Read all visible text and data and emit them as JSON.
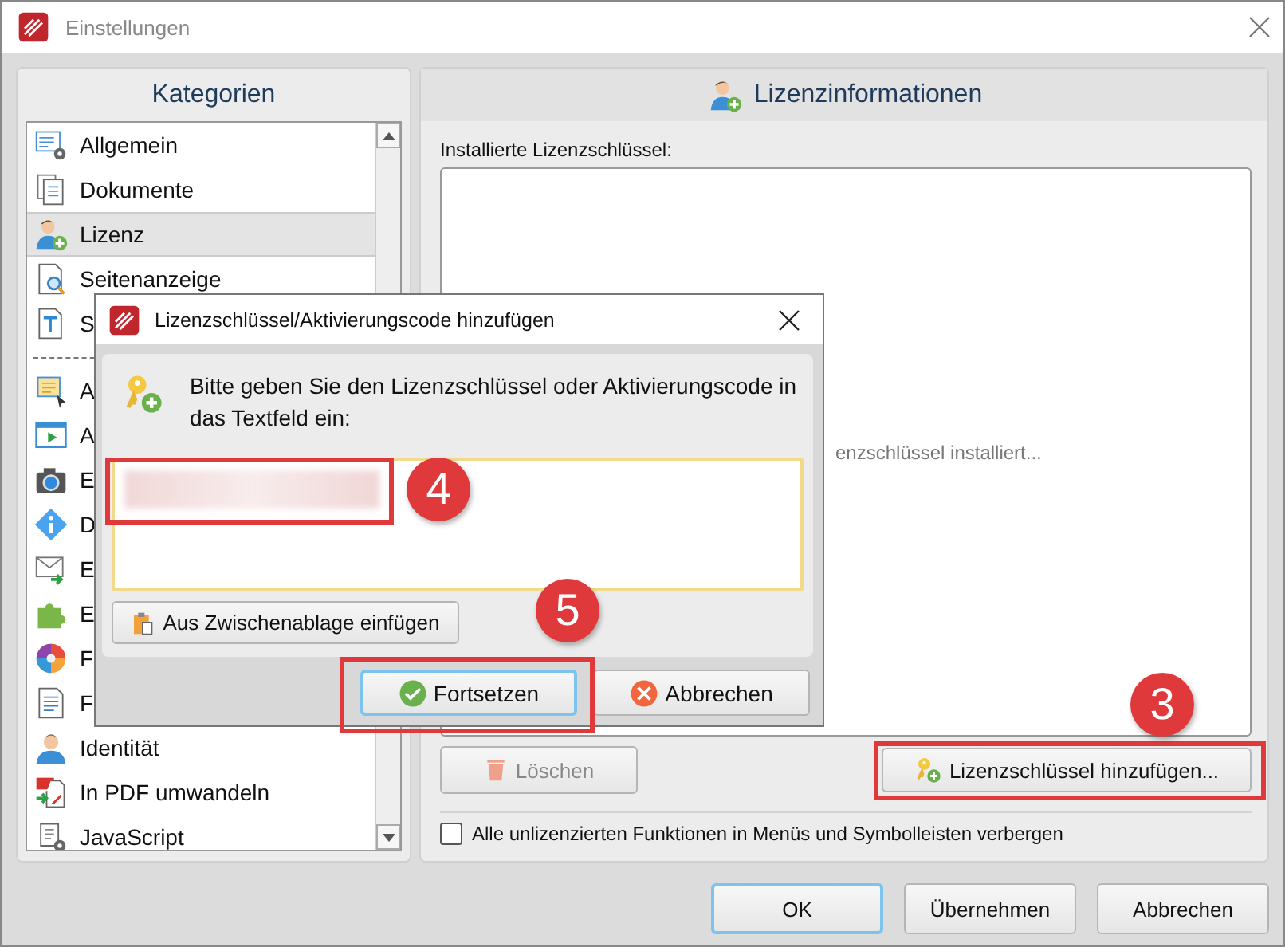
{
  "window": {
    "title": "Einstellungen"
  },
  "sidebar": {
    "title": "Kategorien",
    "groups": [
      [
        {
          "label": "Allgemein",
          "selected": false
        },
        {
          "label": "Dokumente",
          "selected": false
        },
        {
          "label": "Lizenz",
          "selected": true
        },
        {
          "label": "Seitenanzeige",
          "selected": false
        },
        {
          "label": "S",
          "selected": false
        }
      ],
      [
        {
          "label": "A",
          "selected": false
        },
        {
          "label": "A",
          "selected": false
        },
        {
          "label": "E",
          "selected": false
        },
        {
          "label": "D",
          "selected": false
        },
        {
          "label": "E",
          "selected": false
        },
        {
          "label": "E",
          "selected": false
        },
        {
          "label": "F",
          "selected": false
        },
        {
          "label": "F",
          "selected": false
        },
        {
          "label": "Identität",
          "selected": false
        },
        {
          "label": "In PDF umwandeln",
          "selected": false
        },
        {
          "label": "JavaScript",
          "selected": false
        }
      ]
    ]
  },
  "panel": {
    "title": "Lizenzinformationen",
    "installed_label": "Installierte Lizenzschlüssel:",
    "empty_text": "enzschlüssel installiert...",
    "delete_button": {
      "label": "Löschen",
      "disabled": true
    },
    "add_button": {
      "label": "Lizenzschlüssel hinzufügen...",
      "callout": "3"
    },
    "hide_unlicensed": {
      "label": "Alle unlizenzierten Funktionen in Menüs und Symbolleisten verbergen",
      "checked": false
    }
  },
  "buttons": [
    {
      "label": "OK",
      "default": true
    },
    {
      "label": "Übernehmen",
      "default": false
    },
    {
      "label": "Abbrechen",
      "default": false
    }
  ],
  "dialog": {
    "title": "Lizenzschlüssel/Aktivierungscode hinzufügen",
    "message": "Bitte geben Sie den Lizenzschlüssel oder Aktivierungscode in das Textfeld ein:",
    "key_field": {
      "redacted": true,
      "callout": "4"
    },
    "paste_button": "Aus Zwischenablage einfügen",
    "buttons": [
      {
        "label": "Fortsetzen",
        "kind": "confirm",
        "default": true,
        "callout": "5"
      },
      {
        "label": "Abbrechen",
        "kind": "cancel",
        "default": false
      }
    ]
  }
}
